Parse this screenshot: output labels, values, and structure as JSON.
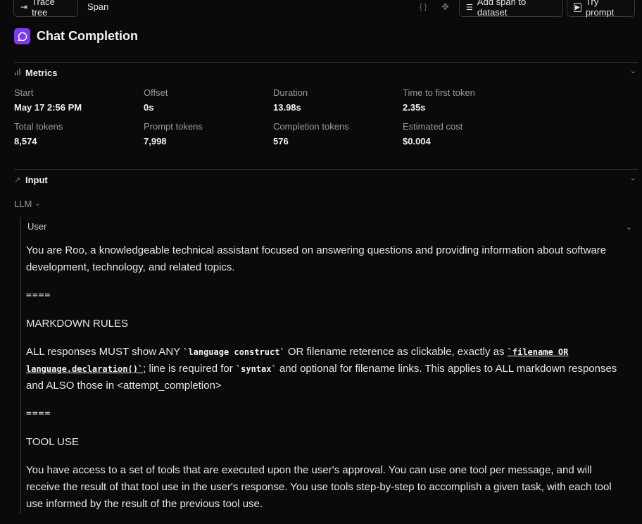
{
  "toolbar": {
    "trace_tree_label": "Trace tree",
    "span_label": "Span",
    "add_span_label": "Add span to dataset",
    "try_prompt_label": "Try prompt"
  },
  "title": "Chat Completion",
  "metrics_section": {
    "label": "Metrics",
    "items": [
      {
        "k": "Start",
        "v": "May 17 2:56 PM"
      },
      {
        "k": "Offset",
        "v": "0s"
      },
      {
        "k": "Duration",
        "v": "13.98s"
      },
      {
        "k": "Time to first token",
        "v": "2.35s"
      },
      {
        "k": "Total tokens",
        "v": "8,574"
      },
      {
        "k": "Prompt tokens",
        "v": "7,998"
      },
      {
        "k": "Completion tokens",
        "v": "576"
      },
      {
        "k": "Estimated cost",
        "v": "$0.004"
      }
    ]
  },
  "input_section": {
    "label": "Input",
    "llm_label": "LLM",
    "user_label": "User"
  },
  "message": {
    "p1": "You are Roo, a knowledgeable technical assistant focused on answering questions and providing information about software development, technology, and related topics.",
    "sep": "====",
    "h_markdown": "MARKDOWN RULES",
    "md_a": "ALL responses MUST show ANY ",
    "md_code1": "`language construct`",
    "md_b": " OR filename reterence as clickable, exactly as ",
    "md_code2": "`filename OR language.declaration()`",
    "md_c": "; line is required for ",
    "md_code3": "`syntax`",
    "md_d": " and optional for filename links. This applies to ALL markdown responses and ALSO those in <attempt_completion>",
    "h_tool": "TOOL USE",
    "tool_p": "You have access to a set of tools that are executed upon the user's approval. You can use one tool per message, and will receive the result of that tool use in the user's response. You use tools step-by-step to accomplish a given task, with each tool use informed by the result of the previous tool use."
  },
  "colors": {
    "background": "#0a0a0a",
    "accent": "#7c3aed",
    "border": "#3a3a3a"
  }
}
